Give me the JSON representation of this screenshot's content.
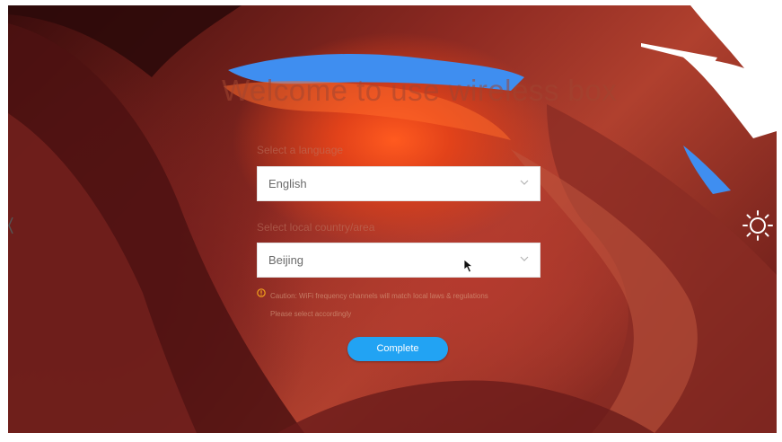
{
  "screen": {
    "title": "Welcome to use wireless box",
    "language": {
      "label": "Select a language",
      "value": "English",
      "icon": "chevron-down-icon"
    },
    "region": {
      "label": "Select local country/area",
      "value": "Beijing",
      "icon": "chevron-down-icon"
    },
    "caution_line1": "Caution: WiFi frequency channels will match local laws & regulations",
    "caution_line2": "Please select accordingly",
    "complete_label": "Complete"
  },
  "icons": {
    "brightness": "sun-icon",
    "cursor": "mouse-pointer-icon",
    "caution": "warning-circle-icon"
  },
  "colors": {
    "button": "#22a3f3",
    "sky": "#3f8ef0",
    "rock_light": "#ff5a1f",
    "rock_dark": "#3a0c0c"
  }
}
